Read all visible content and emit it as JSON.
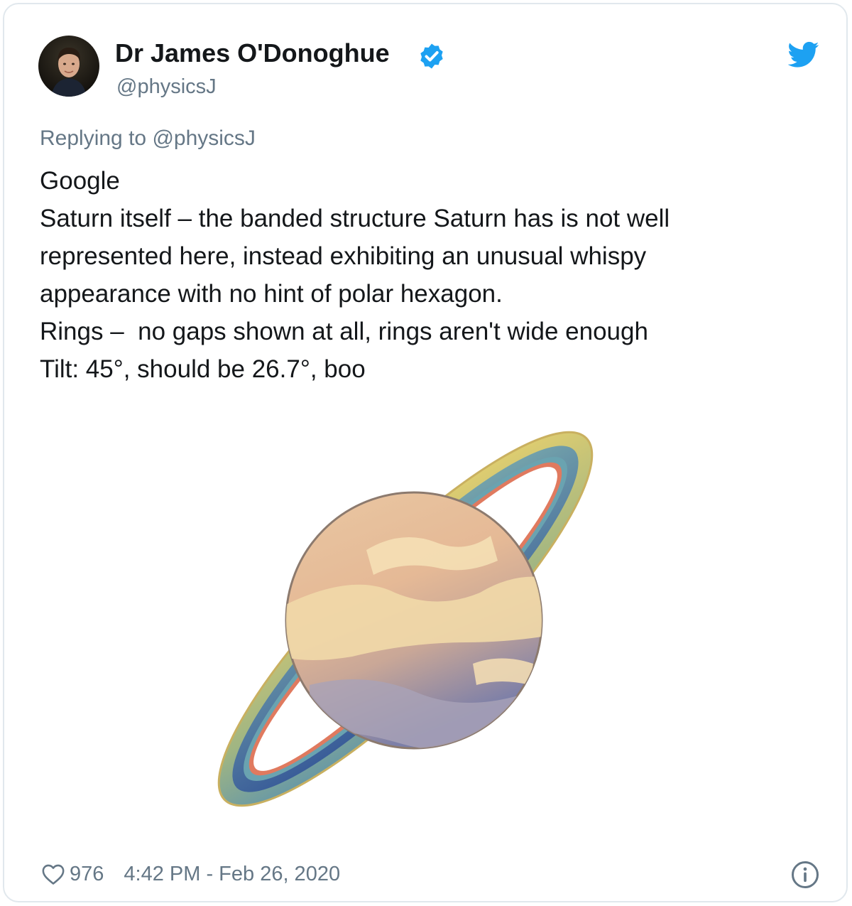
{
  "tweet": {
    "author_name": "Dr James O'Donoghue",
    "handle": "@physicsJ",
    "verified": true,
    "reply_prefix": "Replying to",
    "reply_to": "@physicsJ",
    "text_lines": [
      "Google",
      "Saturn itself – the banded structure Saturn has is not well",
      "represented here, instead exhibiting an unusual whispy",
      "appearance with no hint of polar hexagon.",
      "Rings –  no gaps shown at all, rings aren't wide enough",
      "Tilt: 45°, should be 26.7°, boo"
    ],
    "media_icon": "saturn-emoji-icon",
    "likes": "976",
    "timestamp": "4:42 PM - Feb 26, 2020"
  },
  "icons": {
    "verified": "verified-badge-icon",
    "brand": "twitter-bird-icon",
    "like": "heart-icon",
    "info": "info-icon"
  },
  "colors": {
    "brand_blue": "#1da1f2",
    "text_primary": "#14171a",
    "text_secondary": "#657786",
    "card_border": "#e1e8ed"
  }
}
